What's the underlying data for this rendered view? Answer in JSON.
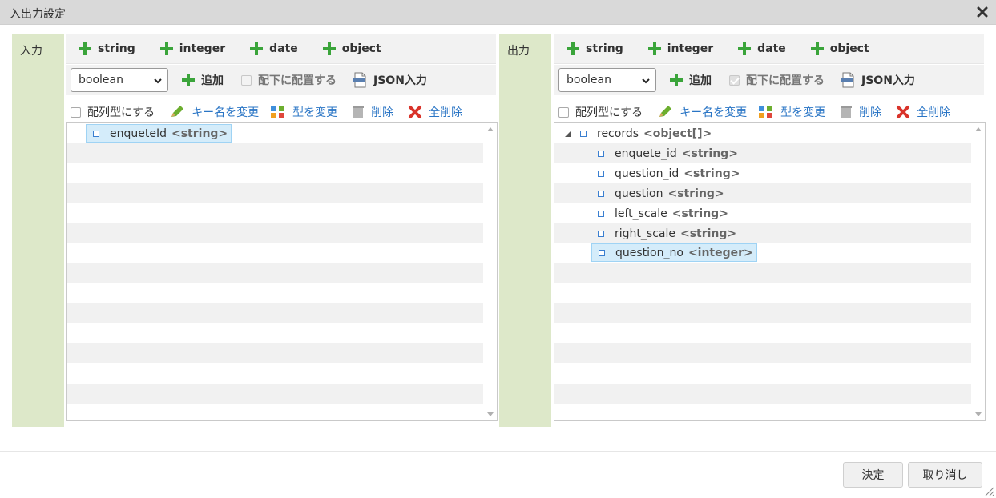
{
  "dialog": {
    "title": "入出力設定"
  },
  "input": {
    "label": "入力",
    "add_types": [
      "string",
      "integer",
      "date",
      "object"
    ],
    "select_value": "boolean",
    "add_label": "追加",
    "child_label": "配下に配置する",
    "child_checked": false,
    "json_label": "JSON入力",
    "array_label": "配列型にする",
    "rename_label": "キー名を変更",
    "change_type_label": "型を変更",
    "delete_label": "削除",
    "delete_all_label": "全削除",
    "tree": [
      {
        "name": "enqueteId",
        "type": "<string>",
        "selected": true
      }
    ]
  },
  "output": {
    "label": "出力",
    "add_types": [
      "string",
      "integer",
      "date",
      "object"
    ],
    "select_value": "boolean",
    "add_label": "追加",
    "child_label": "配下に配置する",
    "child_checked": true,
    "json_label": "JSON入力",
    "array_label": "配列型にする",
    "rename_label": "キー名を変更",
    "change_type_label": "型を変更",
    "delete_label": "削除",
    "delete_all_label": "全削除",
    "tree": [
      {
        "name": "records",
        "type": "<object[]>",
        "expanded": true
      },
      {
        "name": "enquete_id",
        "type": "<string>"
      },
      {
        "name": "question_id",
        "type": "<string>"
      },
      {
        "name": "question",
        "type": "<string>"
      },
      {
        "name": "left_scale",
        "type": "<string>"
      },
      {
        "name": "right_scale",
        "type": "<string>"
      },
      {
        "name": "question_no",
        "type": "<integer>",
        "selected": true
      }
    ]
  },
  "footer": {
    "ok_label": "決定",
    "cancel_label": "取り消し"
  },
  "colors": {
    "accent_link": "#2a75c5",
    "plus_green": "#3aa43a",
    "panel_label_bg": "#dde8c9",
    "selection_bg": "#d4ecfa"
  }
}
